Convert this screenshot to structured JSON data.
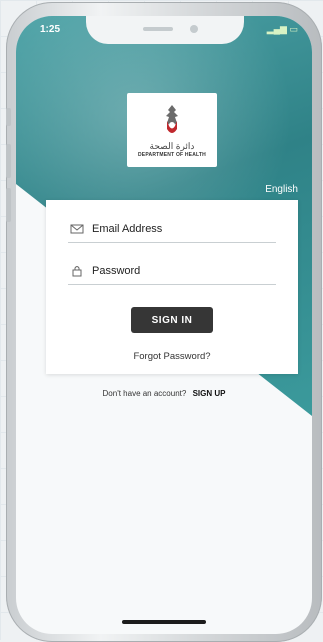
{
  "status_bar": {
    "time": "1:25"
  },
  "brand": {
    "arabic_name": "دائرة الصحة",
    "name": "DEPARTMENT OF HEALTH"
  },
  "language_toggle": "English",
  "form": {
    "email_label": "Email Address",
    "password_label": "Password",
    "signin_label": "SIGN IN",
    "forgot_label": "Forgot Password?"
  },
  "signup": {
    "prompt": "Don't have an account?",
    "link_label": "SIGN UP"
  },
  "colors": {
    "teal": "#2f8287",
    "button": "#363636"
  }
}
